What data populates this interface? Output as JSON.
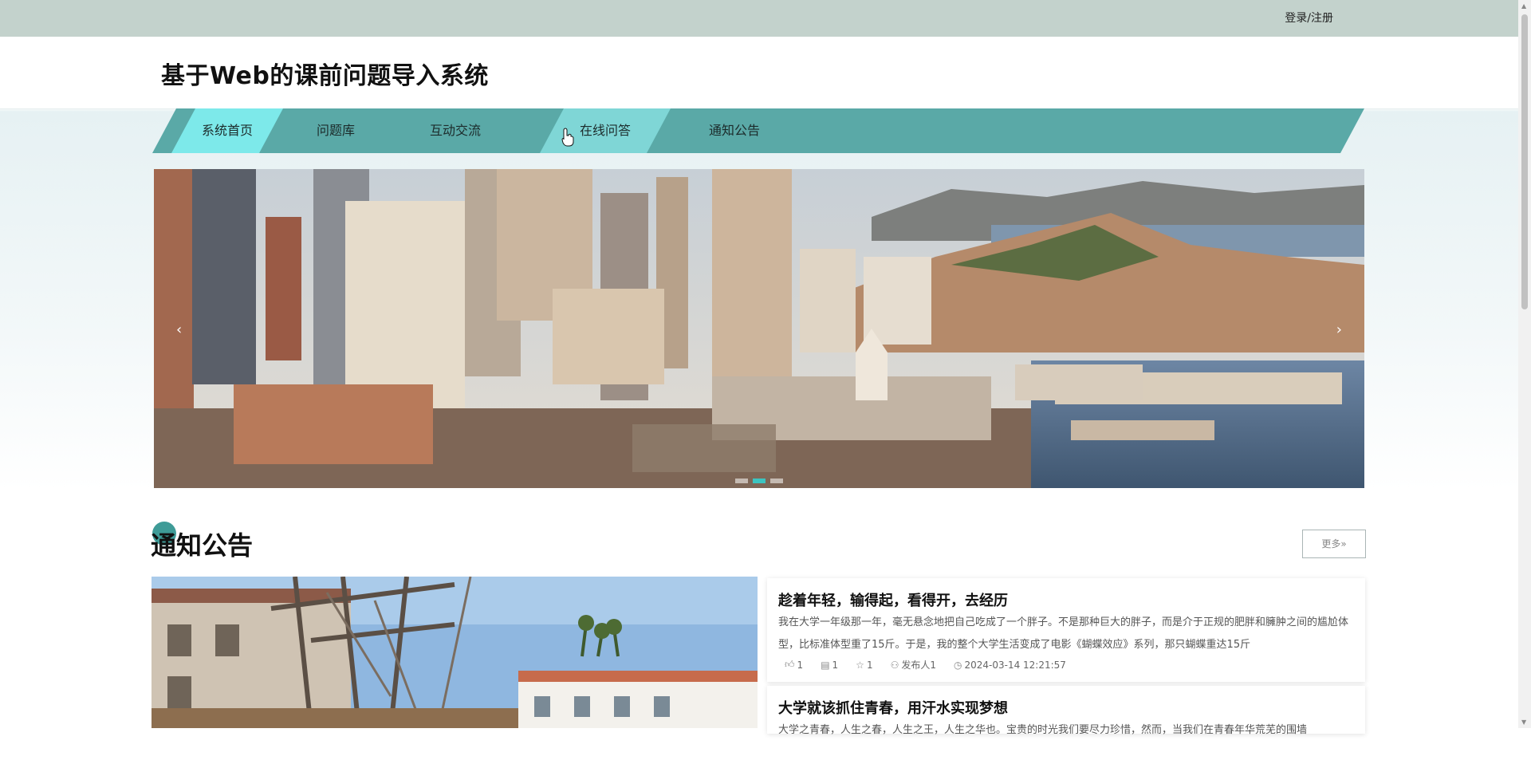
{
  "topbar": {
    "login_label": "登录/注册"
  },
  "site": {
    "title": "基于Web的课前问题导入系统"
  },
  "nav": {
    "items": [
      {
        "label": "系统首页",
        "state": "active"
      },
      {
        "label": "问题库",
        "state": "normal"
      },
      {
        "label": "互动交流",
        "state": "normal"
      },
      {
        "label": "在线问答",
        "state": "hover"
      },
      {
        "label": "通知公告",
        "state": "normal"
      }
    ]
  },
  "banner": {
    "prev_icon": "‹",
    "next_icon": "›",
    "slide_count": 3,
    "active_slide": 2
  },
  "notice_section": {
    "title": "通知公告",
    "more_label": "更多»",
    "articles": [
      {
        "title": "趁着年轻，输得起，看得开，去经历",
        "body": "我在大学一年级那一年，毫无悬念地把自己吃成了一个胖子。不是那种巨大的胖子，而是介于正规的肥胖和臃肿之间的尴尬体型，比标准体型重了15斤。于是，我的整个大学生活变成了电影《蝴蝶效应》系列，那只蝴蝶重达15斤",
        "likes": "1",
        "comments": "1",
        "favorites": "1",
        "publisher": "发布人1",
        "time": "2024-03-14 12:21:57"
      },
      {
        "title": "大学就该抓住青春，用汗水实现梦想",
        "body": "大学之青春，人生之春，人生之王，人生之华也。宝贵的时光我们要尽力珍惜，然而，当我们在青春年华荒芜的围墙",
        "likes": "",
        "comments": "",
        "favorites": "",
        "publisher": "",
        "time": ""
      }
    ]
  },
  "colors": {
    "topbar": "#c3d2cc",
    "nav": "#5aa9a7",
    "nav_active": "#7de9ea",
    "accent": "#3e9b97"
  }
}
